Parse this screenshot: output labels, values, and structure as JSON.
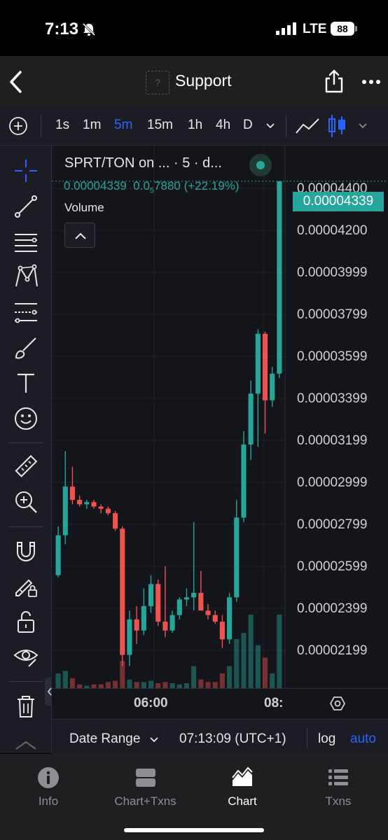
{
  "status": {
    "time": "7:13",
    "network": "LTE",
    "battery": "88"
  },
  "nav": {
    "title": "Support",
    "avatar_placeholder": "?"
  },
  "timeframes": {
    "items": [
      {
        "label": "1s",
        "active": false
      },
      {
        "label": "1m",
        "active": false
      },
      {
        "label": "5m",
        "active": true
      },
      {
        "label": "15m",
        "active": false
      },
      {
        "label": "1h",
        "active": false
      },
      {
        "label": "4h",
        "active": false
      },
      {
        "label": "D",
        "active": false
      }
    ]
  },
  "legend": {
    "title": "SPRT/TON on ... · 5 · d...",
    "last_price": "0.00004339",
    "change_prefix": "0.0",
    "change_sub": "5",
    "change_rest": "7880 (+22.19%)",
    "volume_label": "Volume"
  },
  "price_axis": {
    "labels": [
      "0.00004400",
      "0.00004200",
      "0.00003999",
      "0.00003799",
      "0.00003599",
      "0.00003399",
      "0.00003199",
      "0.00002999",
      "0.00002799",
      "0.00002599",
      "0.00002399",
      "0.00002199"
    ],
    "current": "0.00004339"
  },
  "time_axis": {
    "labels": [
      "06:00",
      "08:"
    ]
  },
  "footer": {
    "date_range": "Date Range",
    "clock": "07:13:09 (UTC+1)",
    "log": "log",
    "auto": "auto"
  },
  "tabs": [
    {
      "label": "Info",
      "icon": "info-icon"
    },
    {
      "label": "Chart+Txns",
      "icon": "split-icon"
    },
    {
      "label": "Chart",
      "icon": "area-chart-icon",
      "active": true
    },
    {
      "label": "Txns",
      "icon": "list-icon"
    }
  ],
  "colors": {
    "up": "#26a69a",
    "down": "#ef5350",
    "accent": "#2962ff",
    "bg": "#14151b"
  },
  "chart_data": {
    "type": "candlestick",
    "pair": "SPRT/TON",
    "interval": "5m",
    "yscale": "linear",
    "ylim": [
      2.05e-05,
      4.5e-05
    ],
    "candles": [
      {
        "o": 2.56e-05,
        "h": 2.78e-05,
        "l": 2.55e-05,
        "c": 2.74e-05,
        "v": 0.12
      },
      {
        "o": 2.74e-05,
        "h": 3.12e-05,
        "l": 2.7e-05,
        "c": 2.96e-05,
        "v": 0.14
      },
      {
        "o": 2.96e-05,
        "h": 3.05e-05,
        "l": 2.88e-05,
        "c": 2.9e-05,
        "v": 0.08
      },
      {
        "o": 2.9e-05,
        "h": 2.92e-05,
        "l": 2.87e-05,
        "c": 2.88e-05,
        "v": 0.03
      },
      {
        "o": 2.88e-05,
        "h": 2.9e-05,
        "l": 2.86e-05,
        "c": 2.89e-05,
        "v": 0.02
      },
      {
        "o": 2.89e-05,
        "h": 2.9e-05,
        "l": 2.86e-05,
        "c": 2.87e-05,
        "v": 0.03
      },
      {
        "o": 2.87e-05,
        "h": 2.88e-05,
        "l": 2.84e-05,
        "c": 2.86e-05,
        "v": 0.03
      },
      {
        "o": 2.86e-05,
        "h": 2.87e-05,
        "l": 2.83e-05,
        "c": 2.84e-05,
        "v": 0.05
      },
      {
        "o": 2.84e-05,
        "h": 2.85e-05,
        "l": 2.76e-05,
        "c": 2.77e-05,
        "v": 0.06
      },
      {
        "o": 2.77e-05,
        "h": 2.78e-05,
        "l": 2.15e-05,
        "c": 2.2e-05,
        "v": 0.22
      },
      {
        "o": 2.2e-05,
        "h": 2.4e-05,
        "l": 2.15e-05,
        "c": 2.36e-05,
        "v": 0.07
      },
      {
        "o": 2.36e-05,
        "h": 2.42e-05,
        "l": 2.25e-05,
        "c": 2.31e-05,
        "v": 0.05
      },
      {
        "o": 2.31e-05,
        "h": 2.5e-05,
        "l": 2.29e-05,
        "c": 2.42e-05,
        "v": 0.05
      },
      {
        "o": 2.42e-05,
        "h": 2.56e-05,
        "l": 2.39e-05,
        "c": 2.52e-05,
        "v": 0.06
      },
      {
        "o": 2.52e-05,
        "h": 2.54e-05,
        "l": 2.33e-05,
        "c": 2.35e-05,
        "v": 0.04
      },
      {
        "o": 2.35e-05,
        "h": 2.6e-05,
        "l": 2.28e-05,
        "c": 2.31e-05,
        "v": 0.05
      },
      {
        "o": 2.31e-05,
        "h": 2.4e-05,
        "l": 2.3e-05,
        "c": 2.38e-05,
        "v": 0.04
      },
      {
        "o": 2.38e-05,
        "h": 2.46e-05,
        "l": 2.36e-05,
        "c": 2.45e-05,
        "v": 0.03
      },
      {
        "o": 2.45e-05,
        "h": 2.5e-05,
        "l": 2.42e-05,
        "c": 2.46e-05,
        "v": 0.04
      },
      {
        "o": 2.46e-05,
        "h": 2.8e-05,
        "l": 2.4e-05,
        "c": 2.48e-05,
        "v": 0.18
      },
      {
        "o": 2.48e-05,
        "h": 2.58e-05,
        "l": 2.45e-05,
        "c": 2.4e-05,
        "v": 0.07
      },
      {
        "o": 2.4e-05,
        "h": 2.43e-05,
        "l": 2.36e-05,
        "c": 2.38e-05,
        "v": 0.05
      },
      {
        "o": 2.38e-05,
        "h": 2.4e-05,
        "l": 2.34e-05,
        "c": 2.35e-05,
        "v": 0.05
      },
      {
        "o": 2.35e-05,
        "h": 2.38e-05,
        "l": 2.23e-05,
        "c": 2.27e-05,
        "v": 0.12
      },
      {
        "o": 2.27e-05,
        "h": 2.48e-05,
        "l": 2.25e-05,
        "c": 2.46e-05,
        "v": 0.18
      },
      {
        "o": 2.46e-05,
        "h": 2.9e-05,
        "l": 2.44e-05,
        "c": 2.82e-05,
        "v": 0.4
      },
      {
        "o": 2.82e-05,
        "h": 3.21e-05,
        "l": 2.8e-05,
        "c": 3.15e-05,
        "v": 0.45
      },
      {
        "o": 3.15e-05,
        "h": 3.44e-05,
        "l": 3.08e-05,
        "c": 3.38e-05,
        "v": 0.6
      },
      {
        "o": 3.38e-05,
        "h": 3.67e-05,
        "l": 3.14e-05,
        "c": 3.65e-05,
        "v": 0.35
      },
      {
        "o": 3.65e-05,
        "h": 3.66e-05,
        "l": 3.2e-05,
        "c": 3.35e-05,
        "v": 0.25
      },
      {
        "o": 3.35e-05,
        "h": 3.5e-05,
        "l": 3.32e-05,
        "c": 3.47e-05,
        "v": 0.12
      },
      {
        "o": 3.47e-05,
        "h": 4.339e-05,
        "l": 3.45e-05,
        "c": 4.339e-05,
        "v": 0.6
      }
    ]
  }
}
